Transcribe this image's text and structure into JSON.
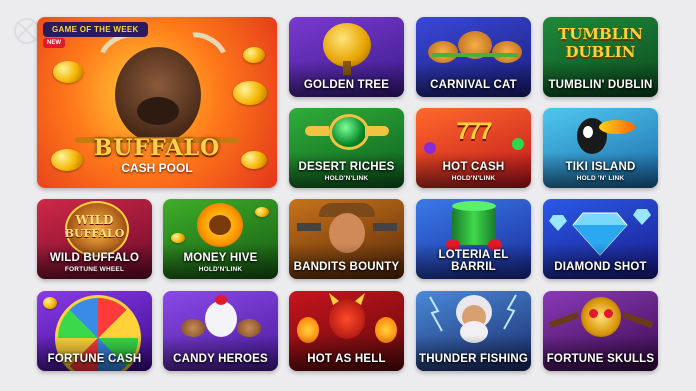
{
  "featured": {
    "badge": "GAME OF THE WEEK",
    "new_label": "NEW",
    "title": "BUFFALO",
    "subtitle": "CASH POOL"
  },
  "games": [
    {
      "title": "GOLDEN TREE",
      "subtitle": ""
    },
    {
      "title": "CARNIVAL CAT",
      "subtitle": ""
    },
    {
      "title": "TUMBLIN' DUBLIN",
      "subtitle": ""
    },
    {
      "title": "DESERT RICHES",
      "subtitle": "HOLD'N'LINK"
    },
    {
      "title": "HOT CASH",
      "subtitle": "HOLD'N'LINK"
    },
    {
      "title": "TIKI ISLAND",
      "subtitle": "HOLD 'N' LINK"
    },
    {
      "title": "WILD BUFFALO",
      "subtitle": "FORTUNE WHEEL"
    },
    {
      "title": "MONEY HIVE",
      "subtitle": "HOLD'N'LINK"
    },
    {
      "title": "BANDITS BOUNTY",
      "subtitle": ""
    },
    {
      "title": "LOTERIA EL BARRIL",
      "subtitle": ""
    },
    {
      "title": "DIAMOND SHOT",
      "subtitle": ""
    },
    {
      "title": "FORTUNE CASH",
      "subtitle": ""
    },
    {
      "title": "CANDY HEROES",
      "subtitle": ""
    },
    {
      "title": "HOT AS HELL",
      "subtitle": ""
    },
    {
      "title": "THUNDER FISHING",
      "subtitle": ""
    },
    {
      "title": "FORTUNE SKULLS",
      "subtitle": ""
    }
  ],
  "art_texts": {
    "tumblin_logo_1": "TUMBLIN",
    "tumblin_logo_2": "DUBLIN",
    "wild_buffalo_logo_1": "WILD",
    "wild_buffalo_logo_2": "BUFFALO"
  },
  "colors": {
    "page_bg": "#ececef",
    "badge_bg": "#2a1b5e",
    "badge_text": "#ffd23a",
    "new_badge": "#e2182b"
  }
}
